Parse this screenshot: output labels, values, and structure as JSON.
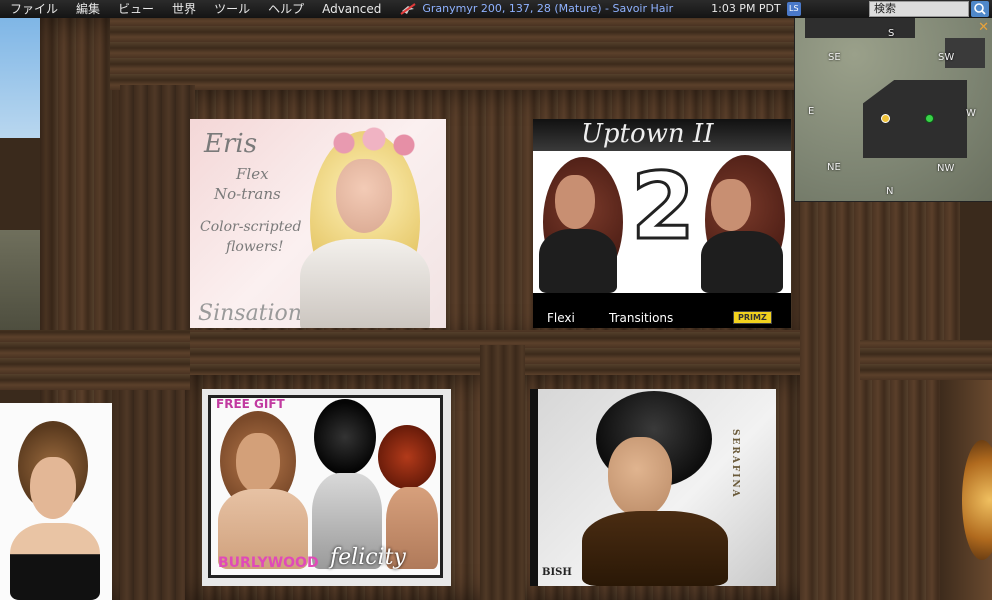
{
  "menubar": {
    "items": [
      "ファイル",
      "編集",
      "ビュー",
      "世界",
      "ツール",
      "ヘルプ",
      "Advanced"
    ],
    "location": "Granymyr 200, 137, 28 (Mature) - Savoir Hair",
    "time": "1:03 PM PDT",
    "ls_badge": "LS",
    "search_placeholder": "検索"
  },
  "minimap": {
    "labels": {
      "s": "S",
      "se": "SE",
      "sw": "SW",
      "e": "E",
      "w": "W",
      "ne": "NE",
      "nw": "NW",
      "n": "N"
    },
    "close": "✕"
  },
  "posters": {
    "eris": {
      "lines": [
        "Eris",
        "Flex",
        "No-trans",
        "Color-scripted",
        "flowers!"
      ],
      "brand": "Sinsation"
    },
    "uptown": {
      "title": "Uptown II",
      "number": "2",
      "left_label": "Flexi",
      "right_label": "Transitions",
      "tag": "PRIMZ"
    },
    "felicity": {
      "free": "FREE GIFT",
      "color": "BURLYWOOD",
      "name": "felicity"
    },
    "serafina": {
      "side": "SERAFINA",
      "brand": "BISH"
    }
  },
  "colors": {
    "menubar_bg": "#1e1e1e",
    "location_text": "#8fb2ff",
    "wood": "#4a3322"
  }
}
